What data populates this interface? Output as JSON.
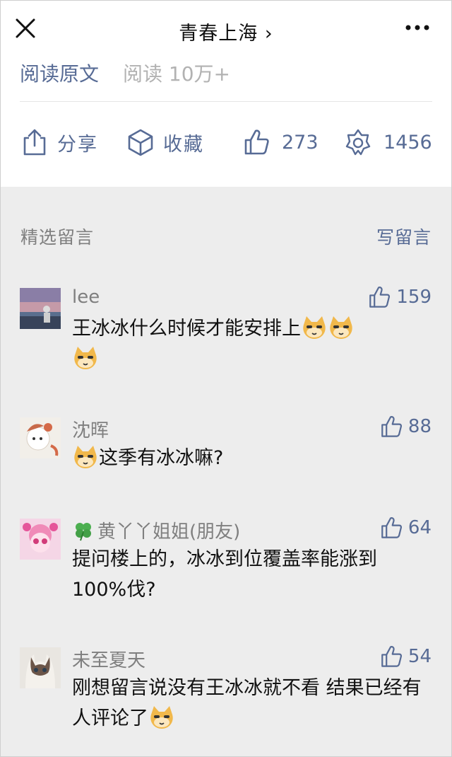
{
  "nav": {
    "close_icon": "close-icon",
    "title": "青春上海 ›",
    "more_icon": "more-icon"
  },
  "article_footer": {
    "read_original": "阅读原文",
    "read_count": "阅读 10万+",
    "actions": [
      {
        "icon": "share-icon",
        "label": "分享"
      },
      {
        "icon": "favorite-icon",
        "label": "收藏"
      },
      {
        "icon": "thumbs-up-icon",
        "label": "273"
      },
      {
        "icon": "wow-icon",
        "label": "1456"
      }
    ]
  },
  "comments_section": {
    "title": "精选留言",
    "write_label": "写留言",
    "comments": [
      {
        "name": "lee",
        "likes": "159",
        "text": "王冰冰什么时候才能安排上"
      },
      {
        "name": "沈晖",
        "likes": "88",
        "text": "这季有冰冰嘛?"
      },
      {
        "name": "黄丫丫姐姐(朋友)",
        "likes": "64",
        "text": "提问楼上的，冰冰到位覆盖率能涨到100%伐?"
      },
      {
        "name": "未至夏天",
        "likes": "54",
        "text": "刚想留言说没有王冰冰就不看 结果已经有人评论了"
      }
    ]
  },
  "colors": {
    "link": "#576b95",
    "muted": "#7f7f7f",
    "background": "#ededed"
  }
}
